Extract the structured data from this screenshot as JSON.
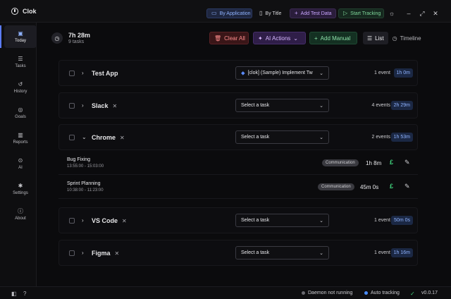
{
  "app": {
    "name": "Clok",
    "version": "v0.0.17"
  },
  "titlebar": {
    "by_application": "By Application",
    "by_title": "By Title",
    "add_test_data": "Add Test Data",
    "start_tracking": "Start Tracking"
  },
  "sidebar": {
    "items": [
      {
        "label": "Today",
        "icon": "calendar-icon"
      },
      {
        "label": "Tasks",
        "icon": "tasks-icon"
      },
      {
        "label": "History",
        "icon": "history-icon"
      },
      {
        "label": "Goals",
        "icon": "target-icon"
      },
      {
        "label": "Reports",
        "icon": "bar-chart-icon"
      },
      {
        "label": "AI",
        "icon": "ai-icon"
      },
      {
        "label": "Settings",
        "icon": "gear-icon"
      },
      {
        "label": "About",
        "icon": "info-icon"
      }
    ]
  },
  "summary": {
    "total_time": "7h 28m",
    "task_count": "9 tasks"
  },
  "actions": {
    "clear_all": "Clear All",
    "ai_actions": "AI Actions",
    "add_manual": "Add Manual",
    "list": "List",
    "timeline": "Timeline"
  },
  "groups": [
    {
      "name": "Test App",
      "task": "[clok] (Sample) Implement Tw",
      "events": "1 event",
      "duration": "1h 0m",
      "expanded": false,
      "removable": false
    },
    {
      "name": "Slack",
      "task": "Select a task",
      "events": "4 events",
      "duration": "2h 29m",
      "expanded": false,
      "removable": true
    },
    {
      "name": "Chrome",
      "task": "Select a task",
      "events": "2 events",
      "duration": "1h 53m",
      "expanded": true,
      "removable": true
    },
    {
      "name": "VS Code",
      "task": "Select a task",
      "events": "1 event",
      "duration": "50m 0s",
      "expanded": false,
      "removable": true
    },
    {
      "name": "Figma",
      "task": "Select a task",
      "events": "1 event",
      "duration": "1h 16m",
      "expanded": false,
      "removable": true
    }
  ],
  "chrome_events": [
    {
      "title": "Bug Fixing",
      "time": "13:55:00 - 15:03:00",
      "tag": "Communication",
      "duration": "1h 8m"
    },
    {
      "title": "Sprint Planning",
      "time": "10:38:00 - 11:23:00",
      "tag": "Communication",
      "duration": "45m 0s"
    }
  ],
  "statusbar": {
    "daemon": "Daemon not running",
    "auto_tracking": "Auto tracking"
  },
  "colors": {
    "accent": "#5c7cff",
    "daemon_dot": "#6a6a70",
    "auto_dot": "#4a8cff",
    "money": "#3ecf7a"
  }
}
